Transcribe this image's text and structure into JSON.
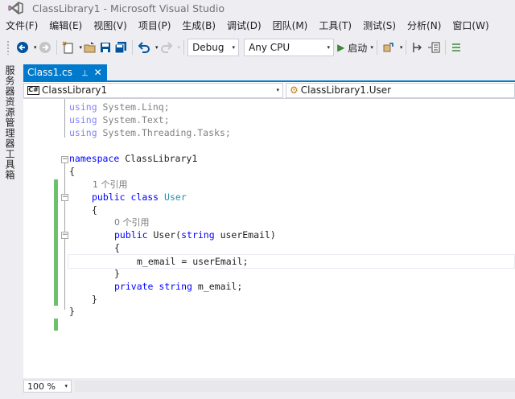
{
  "window": {
    "title": "ClassLibrary1 - Microsoft Visual Studio"
  },
  "menu": [
    "文件(F)",
    "编辑(E)",
    "视图(V)",
    "项目(P)",
    "生成(B)",
    "调试(D)",
    "团队(M)",
    "工具(T)",
    "测试(S)",
    "分析(N)",
    "窗口(W)"
  ],
  "toolbar": {
    "configuration": "Debug",
    "platform": "Any CPU",
    "start_label": "启动"
  },
  "left_panels": [
    "服务器资源管理器",
    "工具箱"
  ],
  "document_tab": {
    "label": "Class1.cs",
    "pin": "⊣",
    "close": "✕"
  },
  "nav": {
    "project": "ClassLibrary1",
    "project_badge": "C#",
    "class": "ClassLibrary1.User"
  },
  "code": {
    "using1_kw": "using",
    "using1": " System.Linq;",
    "using2_kw": "using",
    "using2": " System.Text;",
    "using3_kw": "using",
    "using3": " System.Threading.Tasks;",
    "ns_kw": "namespace",
    "ns_name": " ClassLibrary1",
    "brace_open1": "{",
    "lens1": "1 个引用",
    "class_kw1": "public",
    "class_kw2": "class",
    "class_name": "User",
    "brace_open2": "{",
    "lens2": "0 个引用",
    "ctor_kw": "public",
    "ctor_name": " User(",
    "ctor_type": "string",
    "ctor_param": " userEmail)",
    "brace_open3": "{",
    "assign": "m_email = userEmail;",
    "brace_close3": "}",
    "field_kw1": "private",
    "field_kw2": "string",
    "field_name": " m_email;",
    "brace_close2": "}",
    "brace_close1": "}"
  },
  "zoom": "100 %",
  "colors": {
    "accent": "#007acc",
    "change_marker": "#6cc26c",
    "keyword": "#0000ff",
    "type": "#2b91af"
  }
}
